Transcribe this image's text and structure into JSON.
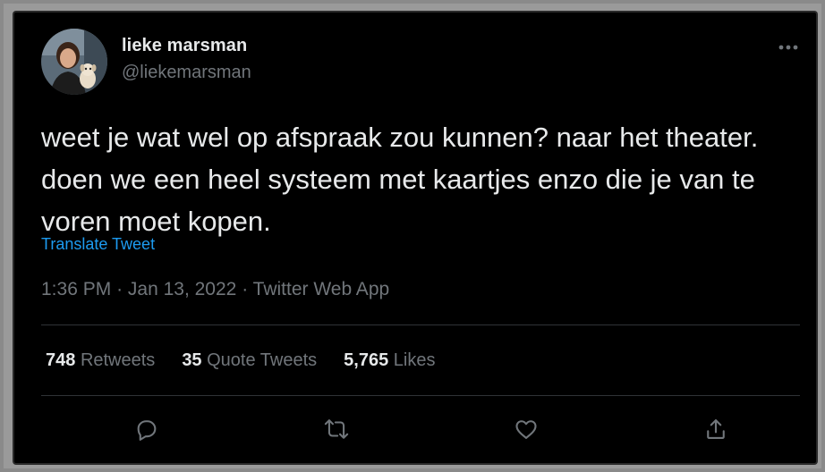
{
  "author": {
    "display_name": "lieke marsman",
    "handle": "@liekemarsman"
  },
  "tweet": {
    "text": "weet je wat wel op afspraak zou kunnen? naar het theater. doen we een heel systeem met kaartjes enzo die je van te voren moet kopen.",
    "translate_label": "Translate Tweet",
    "time": "1:36 PM",
    "date": "Jan 13, 2022",
    "source": "Twitter Web App",
    "separator": "·"
  },
  "stats": {
    "retweets_count": "748",
    "retweets_label": "Retweets",
    "quotes_count": "35",
    "quotes_label": "Quote Tweets",
    "likes_count": "5,765",
    "likes_label": "Likes"
  },
  "icons": {
    "more": "more-horizontal-icon",
    "reply": "reply-icon",
    "retweet": "retweet-icon",
    "like": "heart-icon",
    "share": "share-icon"
  },
  "colors": {
    "background": "#000000",
    "text_primary": "#e7e9ea",
    "text_secondary": "#71767b",
    "link": "#1d9bf0",
    "divider": "#2f3336"
  }
}
